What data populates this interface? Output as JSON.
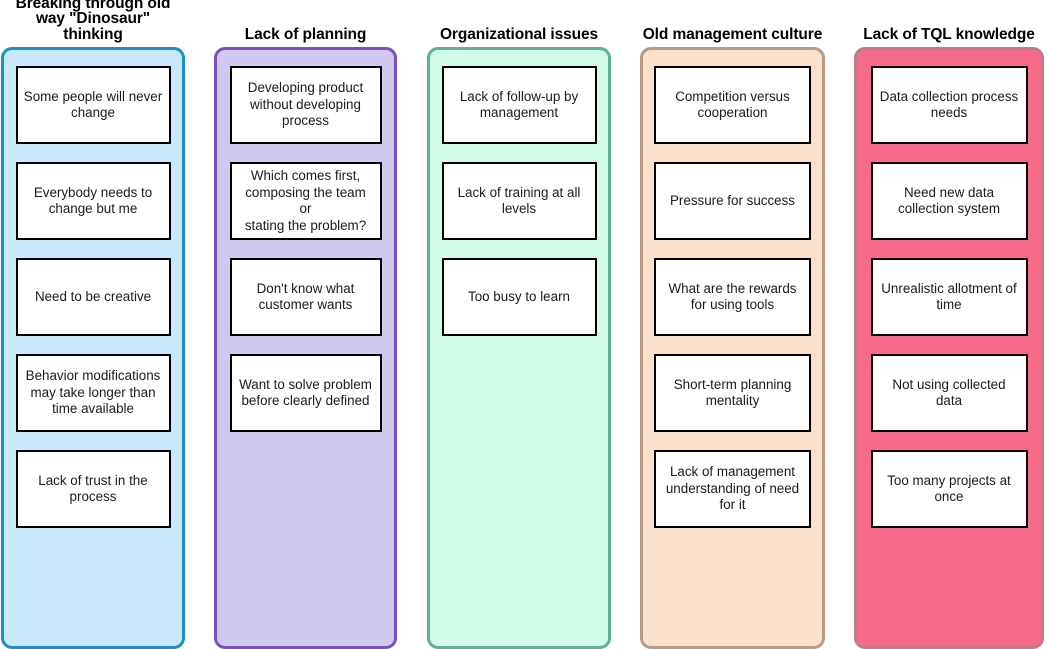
{
  "diagram": {
    "type": "affinity-diagram",
    "columns": [
      {
        "id": "breaking-through-old-thinking",
        "header": "Breaking through old\nway \"Dinosaur\"\nthinking",
        "fill": "#c8e8fb",
        "border": "#1a8fc8",
        "cards": [
          "Some people will never\nchange",
          "Everybody needs to\nchange but me",
          "Need to be creative",
          "Behavior modifications\nmay take longer than\ntime available",
          "Lack of trust in the\nprocess"
        ]
      },
      {
        "id": "lack-of-planning",
        "header": "Lack of planning",
        "fill": "#d0c8ef",
        "border": "#7a4fc0",
        "cards": [
          "Developing product\nwithout developing\nprocess",
          "Which comes first,\ncomposing the team or\nstating the problem?",
          "Don't know what\ncustomer wants",
          "Want to solve problem\nbefore clearly defined"
        ]
      },
      {
        "id": "organizational-issues",
        "header": "Organizational issues",
        "fill": "#d2fbe8",
        "border": "#5cb295",
        "cards": [
          "Lack of follow-up by\nmanagement",
          "Lack of training at all\nlevels",
          "Too busy to learn"
        ]
      },
      {
        "id": "old-management-culture",
        "header": "Old management culture",
        "fill": "#fbe0cc",
        "border": "#b89a82",
        "cards": [
          "Competition versus\ncooperation",
          "Pressure for success",
          "What are the rewards\nfor using tools",
          "Short-term planning\nmentality",
          "Lack of management\nunderstanding of need\nfor it"
        ]
      },
      {
        "id": "lack-of-tql-knowledge",
        "header": "Lack of TQL knowledge",
        "fill": "#f76b8a",
        "border": "#c4788c",
        "cards": [
          "Data collection process\nneeds",
          "Need new data\ncollection system",
          "Unrealistic allotment of\ntime",
          "Not using collected data",
          "Too many projects at\nonce"
        ]
      }
    ]
  }
}
